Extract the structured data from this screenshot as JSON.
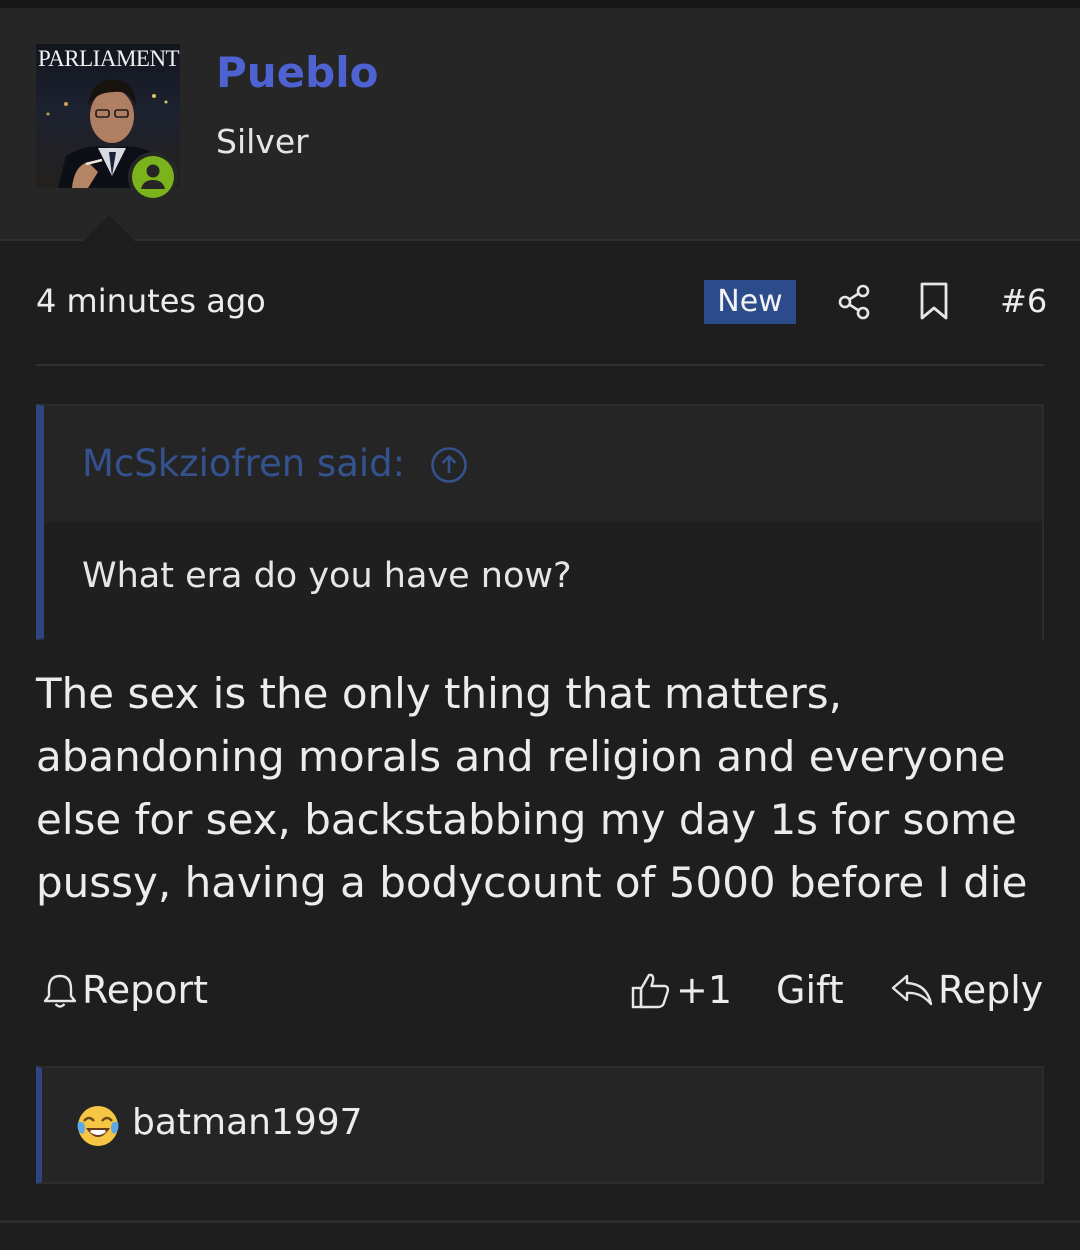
{
  "author": {
    "avatar_caption": "PARLIAMENT",
    "username": "Pueblo",
    "rank": "Silver",
    "status_color": "#7bb31c",
    "username_color": "#4e62d2"
  },
  "post": {
    "timestamp": "4 minutes ago",
    "new_badge": "New",
    "post_number": "#6",
    "quote": {
      "author_label": "McSkziofren said:",
      "text": "What era do you have now?"
    },
    "message": "The sex is the only thing that matters, abandoning morals and religion and everyone else for sex, backstabbing my day 1s for some pussy, having a bodycount of 5000 before I die"
  },
  "actions": {
    "report": "Report",
    "like": "+1",
    "gift": "Gift",
    "reply": "Reply"
  },
  "reactions": {
    "emoji": "face-with-tears-of-joy",
    "user": "batman1997"
  },
  "icons": {
    "share": "share-icon",
    "bookmark": "bookmark-icon",
    "quote_jump": "arrow-up-circle-icon",
    "report": "bell-icon",
    "like": "thumbs-up-icon",
    "reply": "reply-arrow-icon"
  },
  "colors": {
    "background": "#1e1e1e",
    "accent": "#2c4b8a",
    "quote_border": "#2f4581"
  }
}
